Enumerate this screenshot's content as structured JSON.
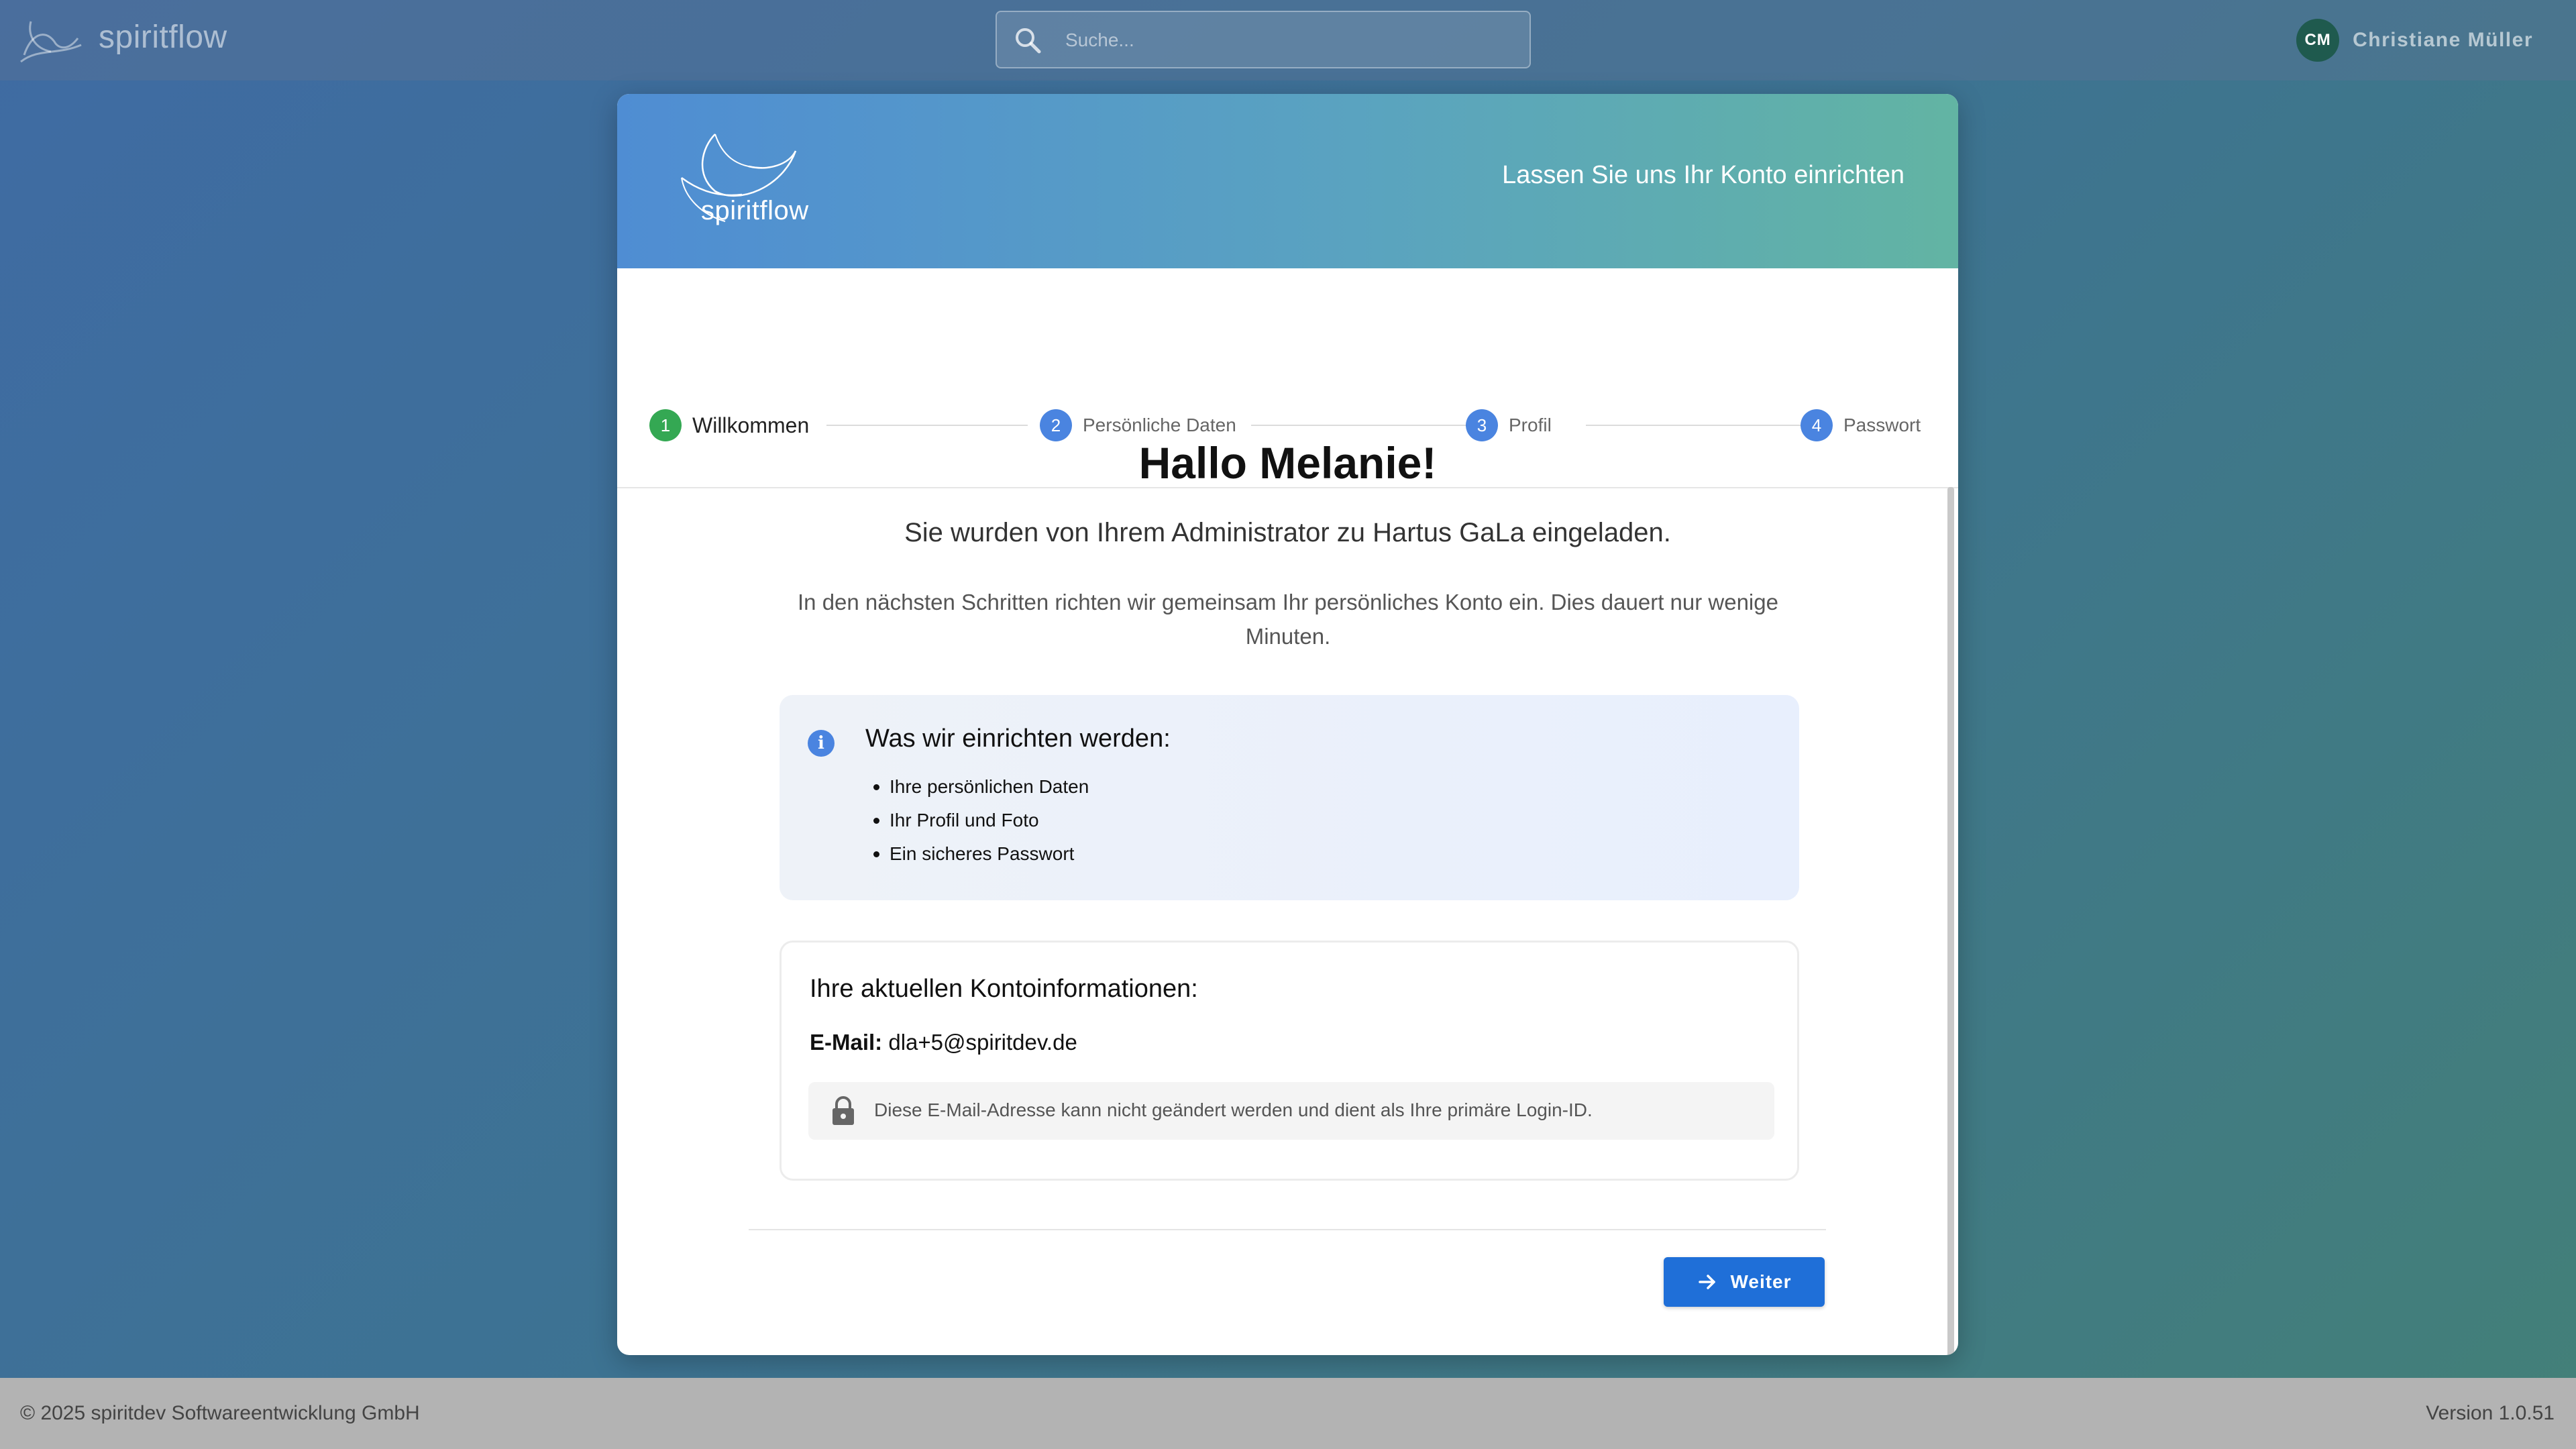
{
  "topbar": {
    "brand": "spiritflow",
    "search_placeholder": "Suche...",
    "user_initials": "CM",
    "user_name": "Christiane Müller"
  },
  "header": {
    "logo_text": "spiritflow",
    "tagline": "Lassen Sie uns Ihr Konto einrichten"
  },
  "steps": [
    {
      "number": "1",
      "label": "Willkommen",
      "active": true
    },
    {
      "number": "2",
      "label": "Persönliche Daten",
      "active": false
    },
    {
      "number": "3",
      "label": "Profil",
      "active": false
    },
    {
      "number": "4",
      "label": "Passwort",
      "active": false
    }
  ],
  "content": {
    "greeting": "Hallo Melanie!",
    "invited_text": "Sie wurden von Ihrem Administrator zu Hartus GaLa eingeladen.",
    "description": "In den nächsten Schritten richten wir gemeinsam Ihr persönliches Konto ein. Dies dauert nur wenige Minuten."
  },
  "info": {
    "title": "Was wir einrichten werden:",
    "items": [
      "Ihre persönlichen Daten",
      "Ihr Profil und Foto",
      "Ein sicheres Passwort"
    ]
  },
  "account": {
    "title": "Ihre aktuellen Kontoinformationen:",
    "email_label": "E-Mail:",
    "email_value": "dla+5@spiritdev.de",
    "notice": "Diese E-Mail-Adresse kann nicht geändert werden und dient als Ihre primäre Login-ID."
  },
  "actions": {
    "next_label": "Weiter"
  },
  "footer": {
    "copyright": "© 2025 spiritdev Softwareentwicklung GmbH",
    "version": "Version 1.0.51"
  },
  "colors": {
    "primary": "#1f6fd8",
    "step_active": "#34a853",
    "step_inactive": "#4a84e0",
    "avatar": "#1f5a4e"
  }
}
